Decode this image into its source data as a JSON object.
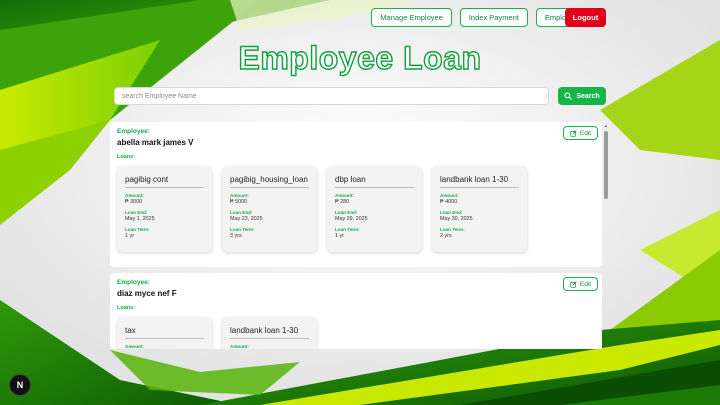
{
  "colors": {
    "accent": "#17b44c",
    "logout": "#e2001a",
    "bg_green_dark": "#1f8a0b",
    "bg_green_light": "#b8e000"
  },
  "nav": {
    "manage_employee": "Manage Employee",
    "index_payment": "Index Payment",
    "employee_loan": "Employee Loan",
    "logout": "Logout"
  },
  "title": "Employee Loan",
  "search": {
    "placeholder": "search Employee Name",
    "value": "",
    "button_label": "Search",
    "icon": "search-icon"
  },
  "employees": [
    {
      "label": "Employee:",
      "name": "abella mark james V",
      "edit_label": "Edit",
      "loans_label": "Loans:",
      "loans": [
        {
          "name": "pagibig cont",
          "amount_label": "Amount:",
          "amount": "₱ 3000",
          "end_label": "Loan End:",
          "end": "May 1, 2025",
          "term_label": "Loan Term:",
          "term": "1 yr"
        },
        {
          "name": "pagibig_housing_loan",
          "amount_label": "Amount:",
          "amount": "₱ 5000",
          "end_label": "Loan End:",
          "end": "May 23, 2025",
          "term_label": "Loan Term:",
          "term": "3 yrs"
        },
        {
          "name": "dbp loan",
          "amount_label": "Amount:",
          "amount": "₱ 280",
          "end_label": "Loan End:",
          "end": "May 29, 2025",
          "term_label": "Loan Term:",
          "term": "1 yr"
        },
        {
          "name": "landbank loan 1-30",
          "amount_label": "Amount:",
          "amount": "₱ 4000",
          "end_label": "Loan End:",
          "end": "May 30, 2025",
          "term_label": "Loan Term:",
          "term": "2 yrs"
        }
      ]
    },
    {
      "label": "Employee:",
      "name": "diaz myce nef F",
      "edit_label": "Edit",
      "loans_label": "Loans:",
      "loans": [
        {
          "name": "tax",
          "amount_label": "Amount:"
        },
        {
          "name": "landbank loan 1-30",
          "amount_label": "Amount:"
        }
      ]
    }
  ],
  "dev_badge": "N"
}
